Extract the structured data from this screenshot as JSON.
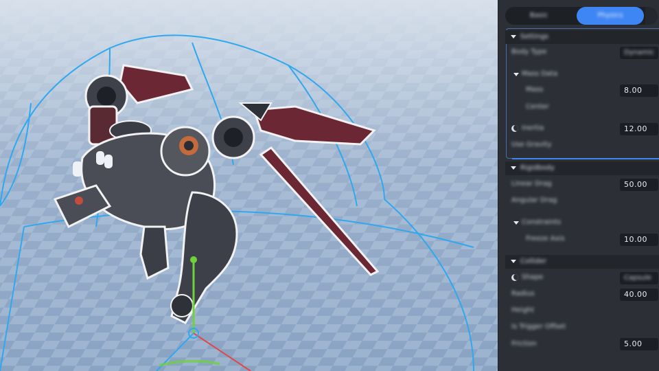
{
  "panel": {
    "tabs": [
      {
        "label": "Basic"
      },
      {
        "label": "Physics"
      },
      {
        "label": ""
      }
    ],
    "sections": [
      {
        "title": "Settings"
      },
      {
        "title": "Rigidbody"
      },
      {
        "title": "Collider"
      }
    ],
    "rows": {
      "r1_label": "Body Type",
      "r1_select": "Dynamic",
      "sub1_title": "Mass Data",
      "r2_label": "Mass",
      "r2_value": "8.00",
      "r3_label": "Center",
      "r4_label": "Inertia",
      "r4_value": "12.00",
      "r5_label": "Use Gravity",
      "r6_label": "Linear Drag",
      "r6_value": "50.00",
      "r7_label": "Angular Drag",
      "sub2_title": "Constraints",
      "r8_label": "Freeze Axis",
      "r8_value": "10.00",
      "r9_label": "Shape",
      "r9_select": "Capsule",
      "r10_label": "Radius",
      "r10_value": "40.00",
      "r11_label": "Height",
      "r12_label": "Is Trigger Offset",
      "r13_label": "Friction",
      "r13_value": "5.00"
    },
    "colors": {
      "accent": "#3f86f5",
      "panel_bg": "#2c3036",
      "section_bg": "#22262b",
      "field_bg": "#1b1e22",
      "gizmo_cyan": "#2fa8ee",
      "gizmo_green": "#6fd23a",
      "gizmo_red": "#e04848"
    }
  }
}
